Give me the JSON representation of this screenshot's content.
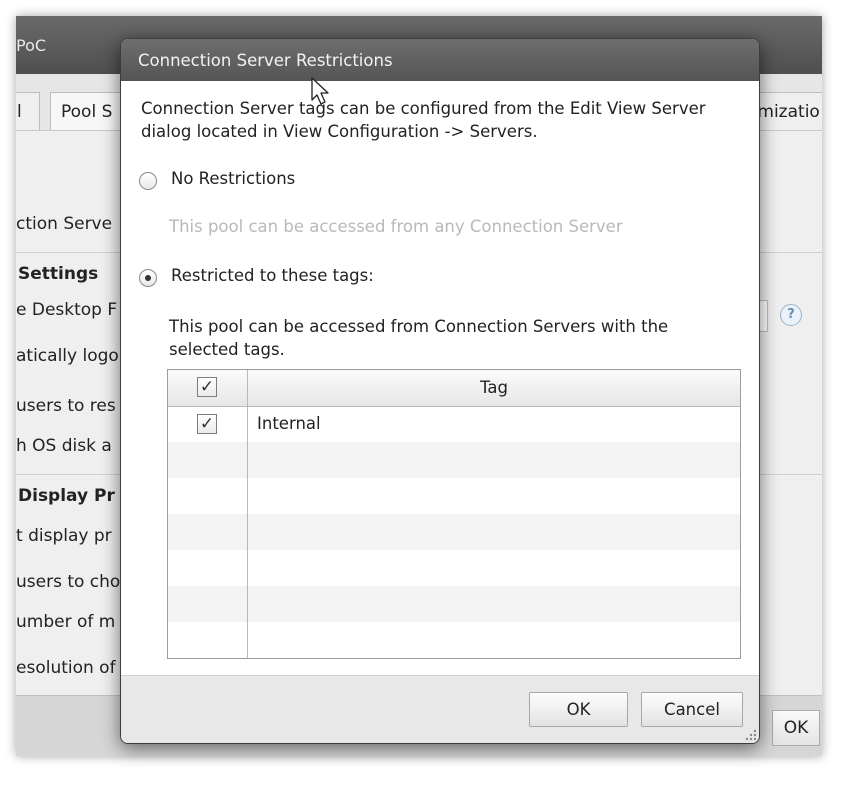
{
  "background_window": {
    "title": "PoC",
    "tabs": [
      "l",
      "Pool S",
      "omizatio"
    ],
    "labels": [
      {
        "text": "ction Serve",
        "bold": false
      },
      {
        "text": "Settings",
        "bold": true
      },
      {
        "text": "e Desktop F",
        "bold": false
      },
      {
        "text": "atically logo",
        "bold": false
      },
      {
        "text": "users to res",
        "bold": false
      },
      {
        "text": "h OS disk a",
        "bold": false
      },
      {
        "text": "Display Pr",
        "bold": true
      },
      {
        "text": "t display pr",
        "bold": false
      },
      {
        "text": "users to cho",
        "bold": false
      },
      {
        "text": "umber of m",
        "bold": false
      },
      {
        "text": "esolution of",
        "bold": false
      }
    ],
    "help_glyph": "?",
    "ok_label": "OK"
  },
  "dialog": {
    "title": "Connection Server Restrictions",
    "description": "Connection Server tags can be configured from the Edit View Server dialog located in View Configuration -> Servers.",
    "options": [
      {
        "label": "No Restrictions",
        "selected": false,
        "hint": "This pool can be accessed from any Connection Server",
        "hint_disabled": true
      },
      {
        "label": "Restricted to these tags:",
        "selected": true,
        "hint": "This pool can be accessed from Connection Servers with the selected tags.",
        "hint_disabled": false
      }
    ],
    "table": {
      "header_checked": true,
      "column_header": "Tag",
      "rows": [
        {
          "checked": true,
          "tag": "Internal"
        }
      ],
      "empty_row_count": 6
    },
    "buttons": {
      "ok": "OK",
      "cancel": "Cancel"
    },
    "check_glyph": "✓"
  }
}
